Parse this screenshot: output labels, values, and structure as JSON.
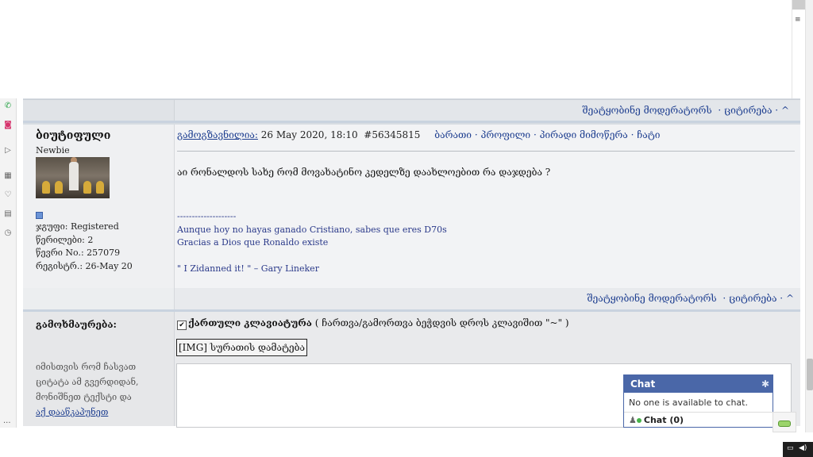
{
  "thread_bar": {
    "report_link": "შეატყობინე მოდერატორს",
    "quote_link": "ციტირება",
    "up_link": "^"
  },
  "post": {
    "author": {
      "name": "ბიუტიფული",
      "rank": "Newbie",
      "group": "ჯგუფი: Registered",
      "posts": "წერილები: 2",
      "member_no": "წევრი No.: 257079",
      "registered": "რეგისტრ.: 26-May 20"
    },
    "header": {
      "author_link": "გამოგზავნილია:",
      "date": "26 May 2020, 18:10",
      "post_id": "#56345815",
      "links": [
        "ბარათი",
        "პროფილი",
        "პირადი მიმოწერა",
        "ჩატი"
      ]
    },
    "text": "აი რონალდოს სახე რომ მოვახატინო კედელზე დაახლოებით რა დაჯდება ?",
    "signature": {
      "divider": "--------------------",
      "line1": "Aunque hoy no hayas ganado Cristiano, sabes que eres D70s",
      "line2": "Gracias a Dios que Ronaldo existe",
      "line3": "\" I Zidanned it! \" – Gary Lineker"
    }
  },
  "post_footer": {
    "report_link": "შეატყობინე მოდერატორს",
    "quote_link": "ციტირება",
    "up_link": "^"
  },
  "reply": {
    "label": "გამოხმაურება:",
    "hint_text": "იმისთვის რომ ჩასვათ ციტატა ამ გვერდიდან, მონიშნეთ ტექსტი და",
    "hint_link": "აქ დააწკაპუნეთ",
    "keyboard_label": "ქართული კლავიატურა",
    "keyboard_hint": "( ჩართვა/გამორთვა ბეჭდვის დროს კლავიშით \"~\" )",
    "img_button": "[IMG] სურათის დამატება"
  },
  "chat": {
    "title": "Chat",
    "status": "No one is available to chat.",
    "footer_label": "Chat",
    "footer_count": "(0)"
  },
  "icons": {
    "sidebar": [
      "whatsapp-icon",
      "instagram-icon",
      "send-icon",
      "apps-icon",
      "heart-icon",
      "news-icon",
      "clock-icon",
      "more-icon"
    ]
  }
}
